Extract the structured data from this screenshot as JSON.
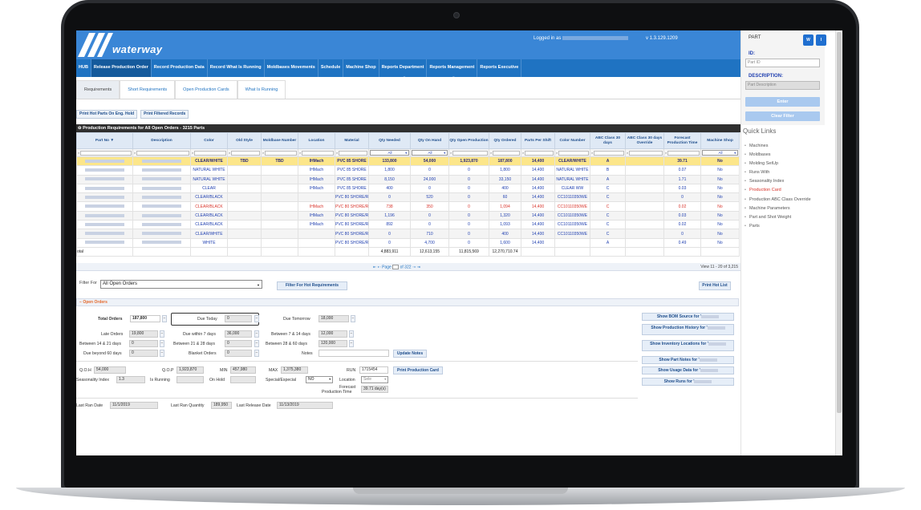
{
  "header": {
    "logo_text": "waterway",
    "logged_in_label": "Logged in as",
    "version": "v 1.3.129.1209"
  },
  "nav": {
    "items": [
      "HUB",
      "Release Production Order",
      "Record Production Data",
      "Record What Is Running",
      "Moldbases Movements",
      "Schedule",
      "Machine Shop",
      "Reports Department",
      "Reports Management",
      "Reports Executive"
    ],
    "active": 1
  },
  "subtabs": [
    "Requirements",
    "Short Requirements",
    "Open Production Cards",
    "What Is Running"
  ],
  "buttons": {
    "print_hot": "Print Hot Parts On Eng. Hold",
    "print_filtered": "Print Filtered Records"
  },
  "grid": {
    "title": "Production Requirements for All Open Orders - 3215 Parts",
    "columns": [
      "Part No ▼",
      "Description",
      "Color",
      "Old Style",
      "Moldbase Number",
      "Location",
      "Material",
      "Qty Needed",
      "Qty On Hand",
      "Qty Open Production",
      "Qty Ordered",
      "Parts Per Shift",
      "Color Number",
      "ABC Class 30 days",
      "ABC Class 30 days Override",
      "Forecast Production Time",
      "Machine Shop"
    ],
    "filter_all": "All",
    "rows": [
      {
        "color": "CLEAR/WHITE",
        "old": "TBD",
        "mold": "TBD",
        "loc": "IHMach",
        "mat": "PVC 85 SHORE",
        "need": "133,800",
        "hand": "54,000",
        "open": "1,923,870",
        "ord": "187,800",
        "pps": "14,400",
        "cnum": "CLEAR/WHITE",
        "abc": "A",
        "ovr": "",
        "fpt": "39.71",
        "ms": "No"
      },
      {
        "color": "NATURAL WHITE",
        "old": "",
        "mold": "",
        "loc": "IHMach",
        "mat": "PVC 85 SHORE",
        "need": "1,800",
        "hand": "0",
        "open": "0",
        "ord": "1,800",
        "pps": "14,400",
        "cnum": "NATURAL WHITE",
        "abc": "B",
        "ovr": "",
        "fpt": "0.07",
        "ms": "No"
      },
      {
        "color": "NATURAL WHITE",
        "old": "",
        "mold": "",
        "loc": "IHMach",
        "mat": "PVC 85 SHORE",
        "need": "8,150",
        "hand": "24,000",
        "open": "0",
        "ord": "33,150",
        "pps": "14,400",
        "cnum": "NATURAL WHITE",
        "abc": "A",
        "ovr": "",
        "fpt": "1.71",
        "ms": "No"
      },
      {
        "color": "CLEAR",
        "old": "",
        "mold": "",
        "loc": "IHMach",
        "mat": "PVC 85 SHORE",
        "need": "400",
        "hand": "0",
        "open": "0",
        "ord": "400",
        "pps": "14,400",
        "cnum": "CLEAR WW",
        "abc": "C",
        "ovr": "",
        "fpt": "0.03",
        "ms": "No"
      },
      {
        "color": "CLEAR/BLACK",
        "old": "",
        "mold": "",
        "loc": "",
        "mat": "PVC 80 SHORE/R",
        "need": "0",
        "hand": "520",
        "open": "0",
        "ord": "60",
        "pps": "14,400",
        "cnum": "CC10110350WE",
        "abc": "C",
        "ovr": "",
        "fpt": "0",
        "ms": "No"
      },
      {
        "color": "CLEAR/BLACK",
        "old": "",
        "mold": "",
        "loc": "IHMach",
        "mat": "PVC 80 SHORE/R",
        "need": "738",
        "hand": "350",
        "open": "0",
        "ord": "1,094",
        "pps": "14,400",
        "cnum": "CC10110350WE",
        "abc": "C",
        "ovr": "",
        "fpt": "0.02",
        "ms": "No"
      },
      {
        "color": "CLEAR/BLACK",
        "old": "",
        "mold": "",
        "loc": "IHMach",
        "mat": "PVC 80 SHORE/R",
        "need": "1,196",
        "hand": "0",
        "open": "0",
        "ord": "1,320",
        "pps": "14,400",
        "cnum": "CC10110350WE",
        "abc": "C",
        "ovr": "",
        "fpt": "0.03",
        "ms": "No"
      },
      {
        "color": "CLEAR/BLACK",
        "old": "",
        "mold": "",
        "loc": "IHMach",
        "mat": "PVC 80 SHORE/R",
        "need": "892",
        "hand": "0",
        "open": "0",
        "ord": "1,093",
        "pps": "14,400",
        "cnum": "CC10110350WE",
        "abc": "C",
        "ovr": "",
        "fpt": "0.02",
        "ms": "No"
      },
      {
        "color": "CLEAR/WHITE",
        "old": "",
        "mold": "",
        "loc": "",
        "mat": "PVC 80 SHORE/R",
        "need": "0",
        "hand": "710",
        "open": "0",
        "ord": "400",
        "pps": "14,400",
        "cnum": "CC10110350WE",
        "abc": "C",
        "ovr": "",
        "fpt": "0",
        "ms": "No"
      },
      {
        "color": "WHITE",
        "old": "",
        "mold": "",
        "loc": "",
        "mat": "PVC 80 SHORE/R",
        "need": "0",
        "hand": "4,700",
        "open": "0",
        "ord": "1,600",
        "pps": "14,400",
        "cnum": "",
        "abc": "A",
        "ovr": "",
        "fpt": "0.49",
        "ms": "No"
      }
    ],
    "totals": {
      "label": "otal",
      "need": "4,883,911",
      "hand": "12,613,155",
      "open": "11,815,569",
      "ord": "12,270,710.74"
    }
  },
  "pager": {
    "prefix": "⇤ ⇠ Page",
    "page": "1",
    "suffix": "of 322 ⇢ ⇥",
    "view": "View 11 - 20 of 3,215"
  },
  "filter": {
    "label": "Filter For",
    "value": "All Open Orders",
    "btn_hot": "Filter For Hot Requirements",
    "btn_print": "Print Hot List"
  },
  "open_orders": {
    "title": "Open Orders",
    "total_orders_label": "Total Orders",
    "total_orders": "187,800",
    "due_today_label": "Due Today",
    "due_today": "0",
    "due_tomorrow_label": "Due Tomorrow",
    "due_tomorrow": "18,000",
    "late_label": "Late Orders",
    "late": "19,800",
    "d7_label": "Due within 7 days",
    "d7": "36,000",
    "d7_14_label": "Between 7 & 14 days",
    "d7_14": "12,000",
    "d14_21_label": "Between 14 & 21 days",
    "d14_21": "0",
    "d21_28_label": "Between 21 & 28 days",
    "d21_28": "0",
    "d28_60_label": "Between 28 & 60 days",
    "d28_60": "120,000",
    "d60_label": "Due beyond 60 days",
    "d60": "0",
    "blanket_label": "Blanket Orders",
    "blanket": "0",
    "notes_label": "Notes",
    "update_notes": "Update Notes",
    "qoh_label": "Q.O.H",
    "qoh": "54,000",
    "qop_label": "Q.O.P",
    "qop": "1,923,870",
    "min_label": "MIN",
    "min": "457,980",
    "max_label": "MAX",
    "max": "1,375,380",
    "run_label": "RUN",
    "run": "1715454",
    "print_card": "Print Production Card",
    "season_label": "Seasonality Index",
    "season": "1.3",
    "isrunning_label": "Is Running",
    "onhold_label": "On Hold",
    "special_label": "Special/Especial",
    "special": "NO",
    "location_label": "Location",
    "location": "Sele",
    "fpt_label1": "Forecast",
    "fpt_label2": "Production Time",
    "fpt": "39.71 day(s)",
    "last_ran_label": "Last Ran Date",
    "last_ran": "11/1/2019",
    "last_qty_label": "Last Ran Quantity",
    "last_qty": "189,950",
    "last_release_label": "Last Release Date",
    "last_release": "11/13/2019"
  },
  "right_buttons": [
    "Show BOM Source for '",
    "Show Production History for '",
    "Show Inventory Locations for '",
    "Show Part Notes for '",
    "Show Usage Data for '",
    "Show Runs for '"
  ],
  "side": {
    "part_label": "PART",
    "w_btn": "W",
    "i_btn": "I",
    "id_label": "ID:",
    "id_placeholder": "Part ID",
    "desc_label": "DESCRIPTION:",
    "desc_placeholder": "Part Description",
    "enter_btn": "Enter",
    "clear_btn": "Clear Filter",
    "quick_links_title": "Quick Links",
    "quick_links": [
      "Machines",
      "Moldbases",
      "Molding SetUp",
      "Runs With",
      "Seasonality Index",
      "Production Card",
      "Production ABC Class Override",
      "Machine Parameters",
      "Part and Shot Weight",
      "Parts"
    ],
    "active_link": 5
  }
}
